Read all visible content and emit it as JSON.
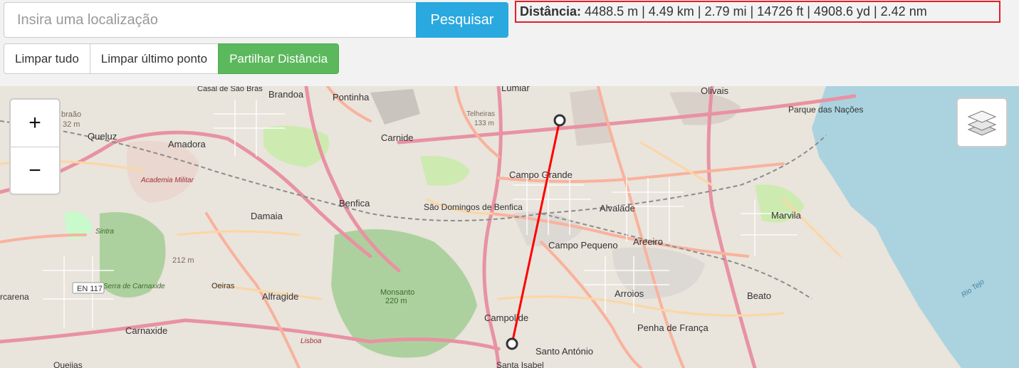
{
  "search": {
    "placeholder": "Insira uma localização",
    "button_label": "Pesquisar"
  },
  "distance": {
    "label": "Distância:",
    "value": "4488.5 m | 4.49 km | 2.79 mi | 14726 ft | 4908.6 yd | 2.42 nm"
  },
  "toolbar": {
    "clear_all": "Limpar tudo",
    "clear_last": "Limpar último ponto",
    "share": "Partilhar Distância"
  },
  "map": {
    "zoom_in": "+",
    "zoom_out": "−",
    "places": {
      "lumiar": "Lumiar",
      "olivais": "Olivais",
      "pontinha": "Pontinha",
      "brandoa": "Brandoa",
      "casal_de_sao_bras": "Casal de São Brás",
      "queluz": "Queluz",
      "amadora": "Amadora",
      "carnide": "Carnide",
      "telheiras": "Telheiras",
      "telheiras_elev": "133 m",
      "parque_das_nacoes": "Parque das Nações",
      "campo_grande": "Campo Grande",
      "academia_militar": "Academia Militar",
      "benfica": "Benfica",
      "sao_domingos": "São Domingos de Benfica",
      "alvalade": "Alvalade",
      "damaia": "Damaia",
      "marvila": "Marvila",
      "campo_pequeno": "Campo Pequeno",
      "areeiro": "Areeiro",
      "elev_212": "212 m",
      "oeiras": "Oeiras",
      "alfragide": "Alfragide",
      "monsanto": "Monsanto",
      "monsanto_elev": "220 m",
      "arroios": "Arroios",
      "beato": "Beato",
      "rio_tejo": "Rio Tejo",
      "serra_carnaxide": "Serra de Carnaxide",
      "en117": "EN 117",
      "carnaxide": "Carnaxide",
      "campolide": "Campolide",
      "penha_de_franca": "Penha de França",
      "santo_antonio": "Santo António",
      "santa_isabel": "Santa Isabel",
      "queijas": "Queijas",
      "sintra": "Sintra",
      "lisboa": "Lisboa",
      "carena": "rcarena",
      "elev_32": "32 m",
      "abraao": "braão"
    }
  },
  "colors": {
    "accent": "#29a9df",
    "share": "#5cb85c",
    "measure_line": "#ff0000",
    "highlight_border": "#e0202a",
    "water": "#aad3df"
  }
}
